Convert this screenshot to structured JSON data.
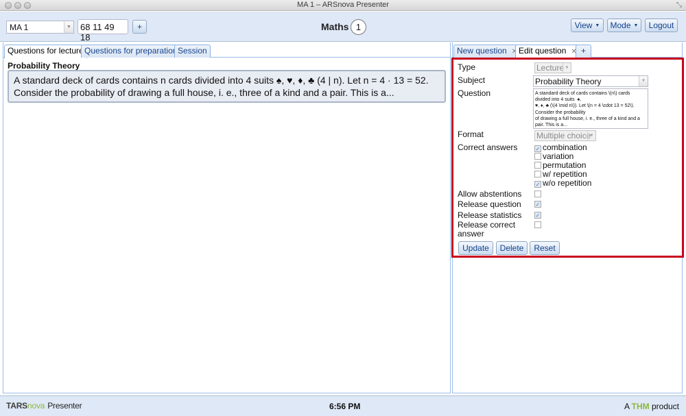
{
  "window": {
    "title": "MA 1 – ARSnova Presenter"
  },
  "toolbar": {
    "course_combo": "MA 1",
    "session_code": "68 11 49 18",
    "add_label": "+",
    "course_title": "Maths",
    "online_count": "1",
    "view_label": "View",
    "mode_label": "Mode",
    "logout_label": "Logout"
  },
  "left_tabs": [
    "Questions for lecture",
    "Questions for preparation",
    "Session"
  ],
  "lecture": {
    "subject": "Probability Theory",
    "question_line1": "A standard deck of cards contains n cards divided into 4 suits ♠, ♥, ♦, ♣ (4 | n). Let n = 4 · 13 = 52.",
    "question_line2": "Consider the probability of drawing a full house, i. e., three of a kind and a pair. This is a..."
  },
  "right_tabs": {
    "new_question": "New question",
    "edit_question": "Edit question",
    "add": "+"
  },
  "edit_form": {
    "type_label": "Type",
    "type_value": "Lecture",
    "subject_label": "Subject",
    "subject_value": "Probability Theory",
    "question_label": "Question",
    "question_value": "A standard deck of cards contains \\(n\\) cards divided into 4 suits  ♠,\n♥, ♦, ♣ (\\(4 \\mid n\\)). Let \\(n = 4 \\cdot 13 = 52\\).\nConsider the probability\nof drawing a full house, i. e., three of a kind and a pair. This is a...",
    "format_label": "Format",
    "format_value": "Multiple choice",
    "correct_label": "Correct answers",
    "answers": [
      {
        "label": "combination",
        "checked": true
      },
      {
        "label": "variation",
        "checked": false
      },
      {
        "label": "permutation",
        "checked": false
      },
      {
        "label": "w/ repetition",
        "checked": false
      },
      {
        "label": "w/o repetition",
        "checked": true
      }
    ],
    "allow_abstentions_label": "Allow abstentions",
    "allow_abstentions": false,
    "release_question_label": "Release question",
    "release_question": true,
    "release_statistics_label": "Release statistics",
    "release_statistics": true,
    "release_correct_label_1": "Release correct",
    "release_correct_label_2": "answer",
    "release_correct": false,
    "update_label": "Update",
    "delete_label": "Delete",
    "reset_label": "Reset"
  },
  "footer": {
    "logo_t": "T",
    "logo_ars": "ARS",
    "logo_nova": "nova",
    "logo_presenter": "Presenter",
    "time": "6:56 PM",
    "credit_prefix": "A",
    "credit_thm": "THM",
    "credit_suffix": "product"
  },
  "colors": {
    "highlight_frame": "#c8001d",
    "toolbar_bg": "#dfe8f6",
    "accent_green": "#8cb83a"
  }
}
